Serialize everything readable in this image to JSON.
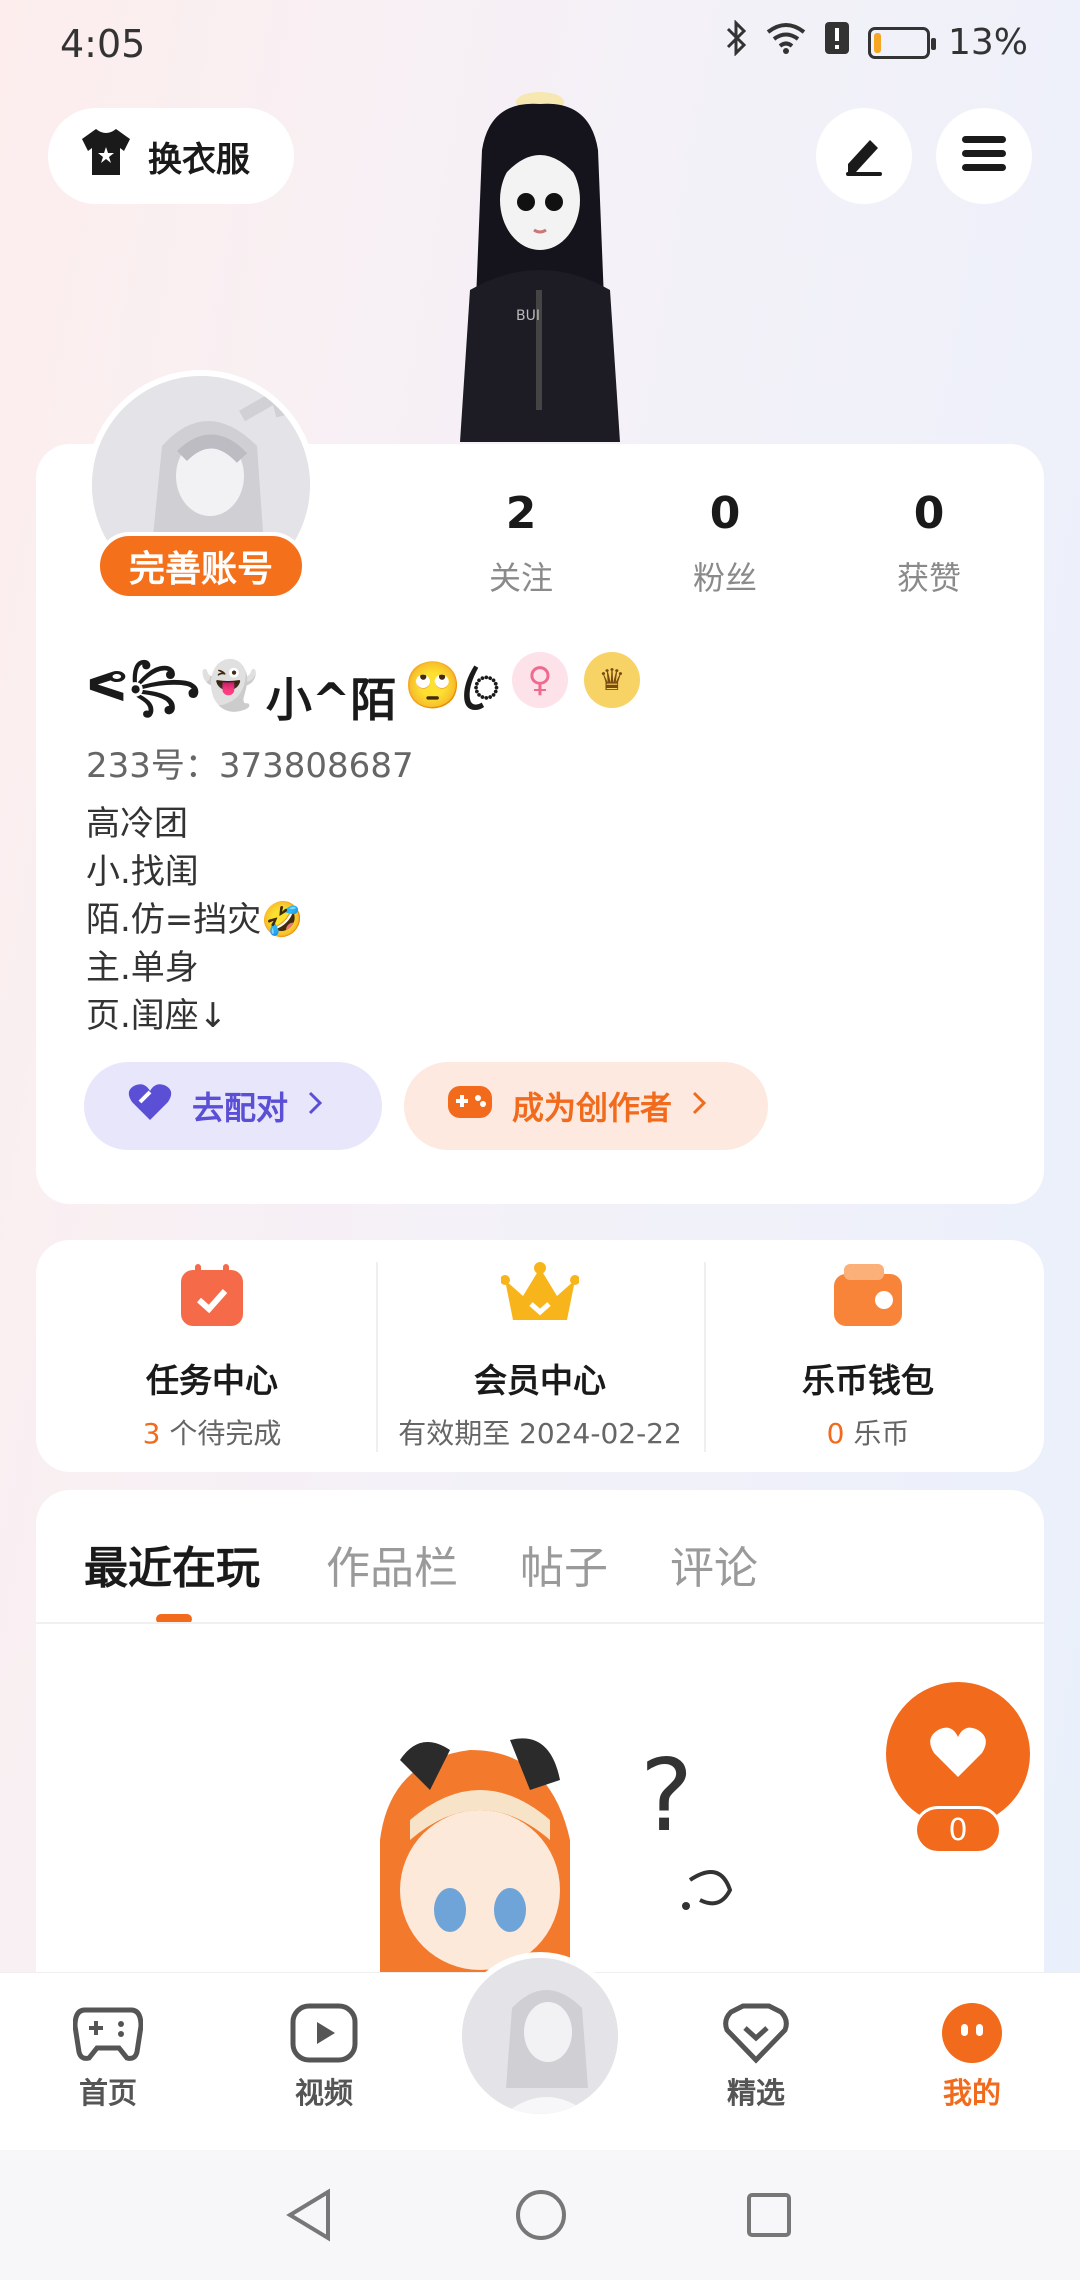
{
  "status_bar": {
    "time": "4:05",
    "battery_percent": "13%",
    "battery_level": 0.13
  },
  "top_bar": {
    "outfit_label": "换衣服",
    "edit_icon": "pen-icon",
    "menu_icon": "hamburger-icon"
  },
  "profile": {
    "complete_account_label": "完善账号",
    "stats": [
      {
        "value": "2",
        "label": "关注"
      },
      {
        "value": "0",
        "label": "粉丝"
      },
      {
        "value": "0",
        "label": "获赞"
      }
    ],
    "nickname_left": "ᕙ꧂👻",
    "nickname": "小^陌",
    "nickname_right": "🙄ꦿ",
    "gender_symbol": "♀",
    "crown_symbol": "♛",
    "uid": "233号：373808687",
    "bio": [
      "高冷团",
      "小.找闺",
      "陌.仿=挡灾🤣",
      "主.单身",
      "页.闺座↓"
    ],
    "pair_label": "去配对",
    "creator_label": "成为创作者"
  },
  "services": [
    {
      "title": "任务中心",
      "sub_highlight": "3",
      "sub_text": " 个待完成"
    },
    {
      "title": "会员中心",
      "sub_highlight": "",
      "sub_text": "有效期至 2024-02-22"
    },
    {
      "title": "乐币钱包",
      "sub_highlight": "0",
      "sub_text": " 乐币"
    }
  ],
  "tabs": [
    "最近在玩",
    "作品栏",
    "帖子",
    "评论"
  ],
  "favorite_count": "0",
  "bottom_nav": [
    {
      "label": "首页"
    },
    {
      "label": "视频"
    },
    {
      "label": "精选"
    },
    {
      "label": "我的"
    }
  ],
  "colors": {
    "accent": "#f26a1b",
    "pair_purple": "#5b4fd6"
  }
}
